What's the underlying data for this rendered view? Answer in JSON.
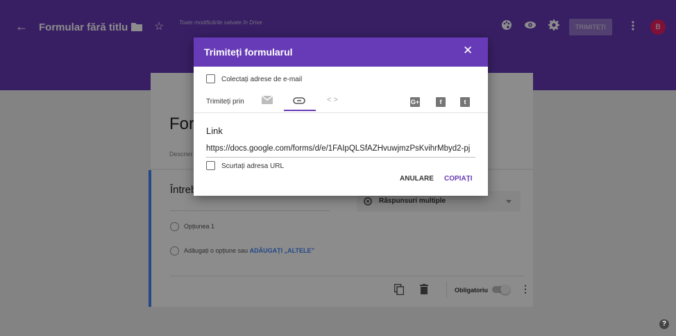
{
  "topbar": {
    "title": "Formular fără titlu",
    "saved_status": "Toate modificările salvate în Drive",
    "send_label": "TRIMITEȚI",
    "avatar_letter": "B",
    "bg_color": "#673ab7"
  },
  "form": {
    "title_partial": "For",
    "description_partial": "Descrier",
    "question_title_partial": "Întreb",
    "question_type": "Răspunsuri multiple",
    "option_1": "Opțiunea 1",
    "add_option_text": "Adăugați o opțiune",
    "add_option_or": "sau",
    "add_other_label": "ADĂUGAȚI „ALTELE”",
    "required_label": "Obligatoriu"
  },
  "dialog": {
    "title": "Trimiteți formularul",
    "collect_emails_label": "Colectați adrese de e-mail",
    "send_via_label": "Trimiteți prin",
    "link_label": "Link",
    "link_url": "https://docs.google.com/forms/d/e/1FAIpQLSfAZHvuwjmzPsKvihrMbyd2-pj",
    "shorten_url_label": "Scurtați adresa URL",
    "cancel_label": "ANULARE",
    "copy_label": "COPIAȚI",
    "accent_color": "#673ab7"
  },
  "icons": {
    "back": "arrow-left-icon",
    "folder": "folder-icon",
    "star": "star-icon",
    "palette": "palette-icon",
    "preview": "eye-icon",
    "settings": "gear-icon",
    "more": "more-vert-icon",
    "help": "help-icon"
  }
}
